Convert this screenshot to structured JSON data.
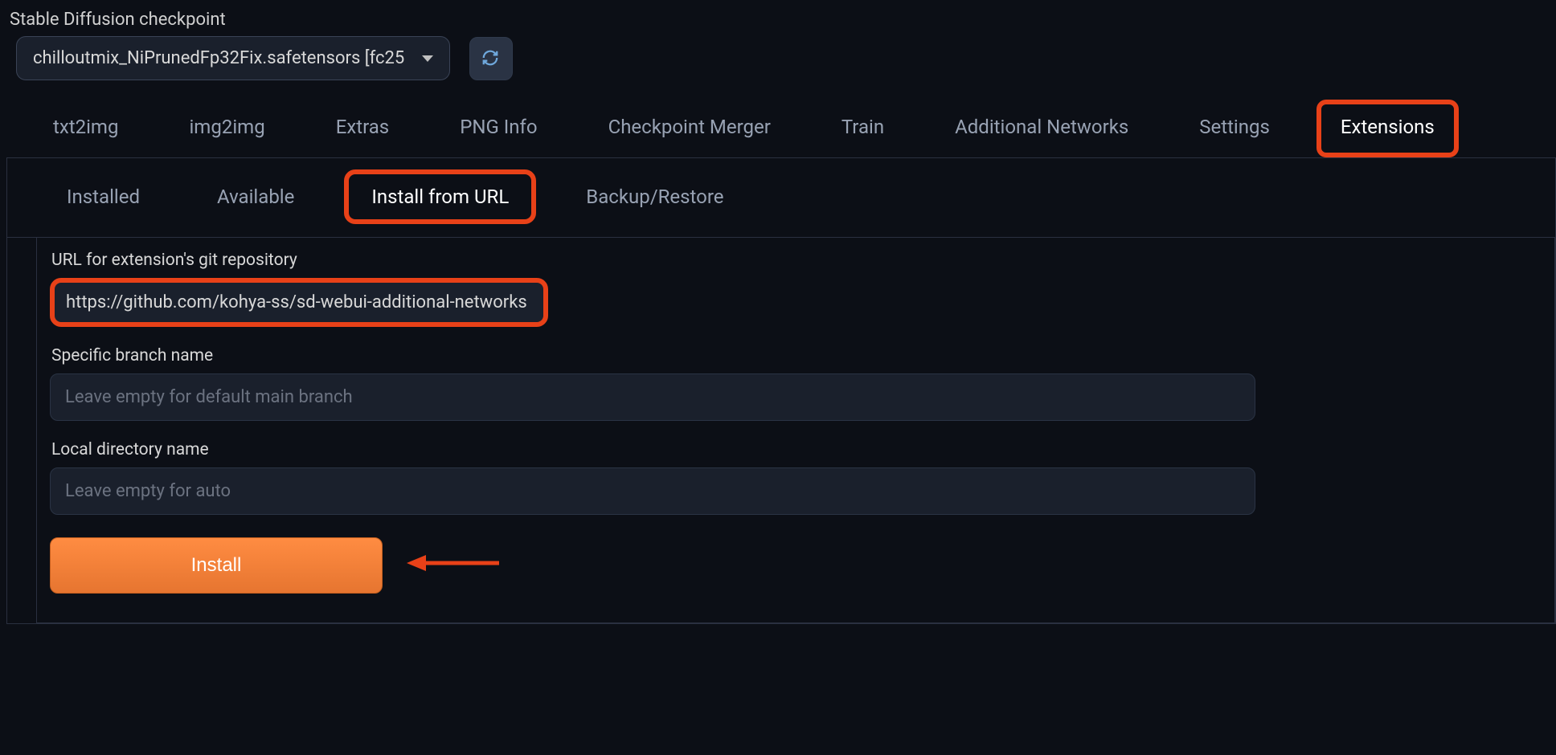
{
  "header": {
    "checkpoint_label": "Stable Diffusion checkpoint",
    "checkpoint_value": "chilloutmix_NiPrunedFp32Fix.safetensors [fc25"
  },
  "tabs": [
    {
      "label": "txt2img",
      "active": false,
      "highlighted": false
    },
    {
      "label": "img2img",
      "active": false,
      "highlighted": false
    },
    {
      "label": "Extras",
      "active": false,
      "highlighted": false
    },
    {
      "label": "PNG Info",
      "active": false,
      "highlighted": false
    },
    {
      "label": "Checkpoint Merger",
      "active": false,
      "highlighted": false
    },
    {
      "label": "Train",
      "active": false,
      "highlighted": false
    },
    {
      "label": "Additional Networks",
      "active": false,
      "highlighted": false
    },
    {
      "label": "Settings",
      "active": false,
      "highlighted": false
    },
    {
      "label": "Extensions",
      "active": true,
      "highlighted": true
    }
  ],
  "sub_tabs": [
    {
      "label": "Installed",
      "highlighted": false
    },
    {
      "label": "Available",
      "highlighted": false
    },
    {
      "label": "Install from URL",
      "highlighted": true
    },
    {
      "label": "Backup/Restore",
      "highlighted": false
    }
  ],
  "form": {
    "url_label": "URL for extension's git repository",
    "url_value": "https://github.com/kohya-ss/sd-webui-additional-networks",
    "branch_label": "Specific branch name",
    "branch_placeholder": "Leave empty for default main branch",
    "branch_value": "",
    "dir_label": "Local directory name",
    "dir_placeholder": "Leave empty for auto",
    "dir_value": "",
    "install_label": "Install"
  },
  "colors": {
    "highlight": "#e84118",
    "accent": "#ff8c42"
  }
}
